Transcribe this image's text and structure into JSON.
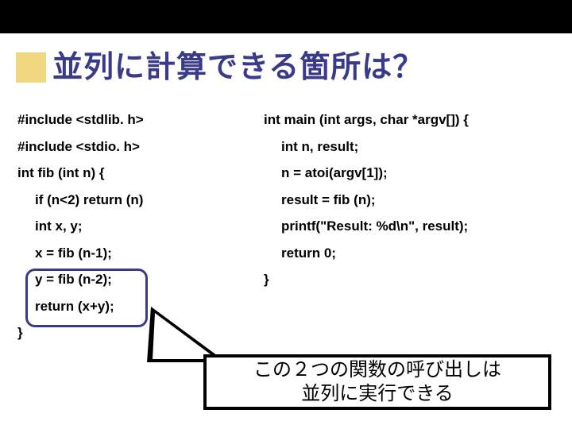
{
  "title": "並列に計算できる箇所は？",
  "code": {
    "left": [
      "#include <stdlib. h>",
      "#include <stdio. h>",
      "int fib (int n) {",
      "if (n<2) return (n)",
      "int x, y;",
      "x = fib (n-1);",
      "y = fib (n-2);",
      "return (x+y);",
      "}"
    ],
    "right": [
      "int main (int args, char *argv[]) {",
      "int n, result;",
      "n = atoi(argv[1]);",
      "result = fib (n);",
      "printf(\"Result: %d\\n\", result);",
      "return 0;",
      "}"
    ]
  },
  "callout": {
    "line1": "この２つの関数の呼び出しは",
    "line2": "並列に実行できる"
  }
}
